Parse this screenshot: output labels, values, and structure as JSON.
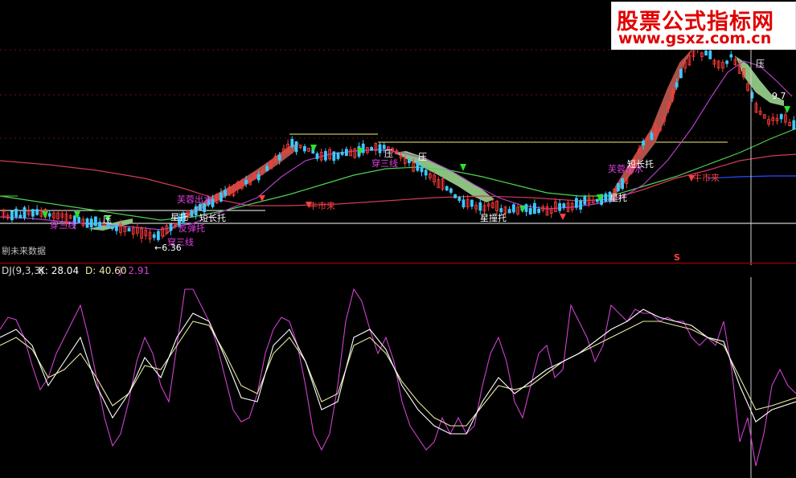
{
  "watermark": {
    "title": "股票公式指标网",
    "url": "www.gsxz.com.cn"
  },
  "indicator": {
    "name": "DJ(9,3,3)",
    "k_label": "K: 28.04",
    "d_label": "D: 40.60",
    "j_label": "J: 2.91"
  },
  "main_chart": {
    "notice": "剔未来数据",
    "low_value": "←6.36",
    "right_value": "9.7",
    "marker_s": "S",
    "signals": {
      "sanxian_left": "穿三线",
      "ya_left": "压",
      "ya_mid_1": "压",
      "ya_mid_2": "压",
      "xiufu_left": "芙蓉出水",
      "duanchang_left": "短长托",
      "fantan_left": "反弹托",
      "jiantuo_left": "星托",
      "sanxian_mid": "穿三线",
      "shuangtuo_mid": "星撞托",
      "niu_left": "牛市来",
      "xiufu_right": "芙蓉出水",
      "duanchang_right": "短长托",
      "jiantuo_right": "星托",
      "niu_right": "牛市来",
      "ya_right": "压"
    }
  },
  "colors": {
    "up_candle": "#ff3b3b",
    "down_candle": "#3cc8ff",
    "k_line": "#ffffff",
    "d_line": "#e8e8a0",
    "j_line": "#d040d0",
    "ma_green": "#4fd24f",
    "ma_red": "#d23a5a",
    "ma_purple": "#b040c8",
    "band_red": "#b05048",
    "band_green": "#8cc080",
    "divider": "#a00000",
    "signal_magenta": "#e040e0",
    "signal_white": "#ffffff",
    "watermark_red": "#e00000"
  }
}
